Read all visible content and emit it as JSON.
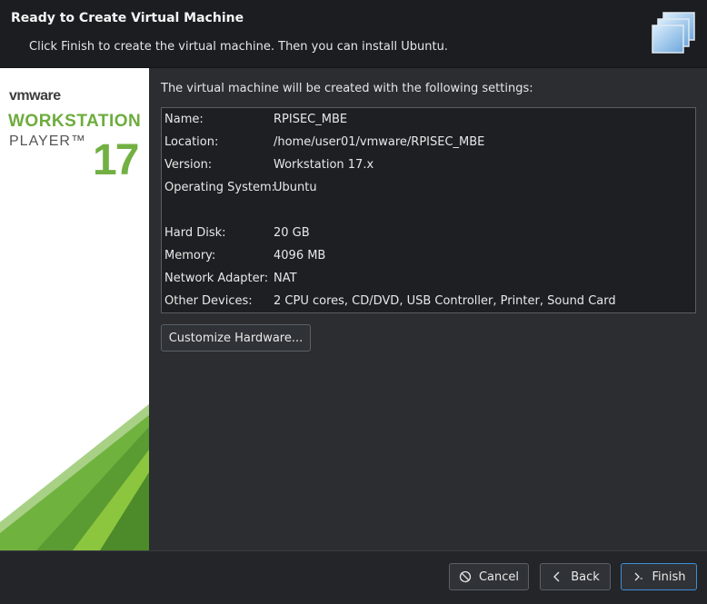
{
  "header": {
    "title": "Ready to Create Virtual Machine",
    "subtitle": "Click Finish to create the virtual machine. Then you can install Ubuntu.",
    "icon": "vm-stack-icon"
  },
  "brand": {
    "vendor": "vmware",
    "product_line1": "WORKSTATION",
    "product_line2": "PLAYER™",
    "version": "17",
    "accent_color": "#72b043"
  },
  "main": {
    "intro": "The virtual machine will be created with the following settings:",
    "settings": [
      {
        "label": "Name:",
        "value": "RPISEC_MBE"
      },
      {
        "label": "Location:",
        "value": "/home/user01/vmware/RPISEC_MBE"
      },
      {
        "label": "Version:",
        "value": "Workstation 17.x"
      },
      {
        "label": "Operating System:",
        "value": "Ubuntu"
      },
      {
        "label": "Hard Disk:",
        "value": "20 GB"
      },
      {
        "label": "Memory:",
        "value": "4096 MB"
      },
      {
        "label": "Network Adapter:",
        "value": "NAT"
      },
      {
        "label": "Other Devices:",
        "value": "2 CPU cores, CD/DVD, USB Controller, Printer, Sound Card"
      }
    ],
    "customize_label": "Customize Hardware..."
  },
  "footer": {
    "cancel_label": "Cancel",
    "back_label": "Back",
    "finish_label": "Finish"
  }
}
